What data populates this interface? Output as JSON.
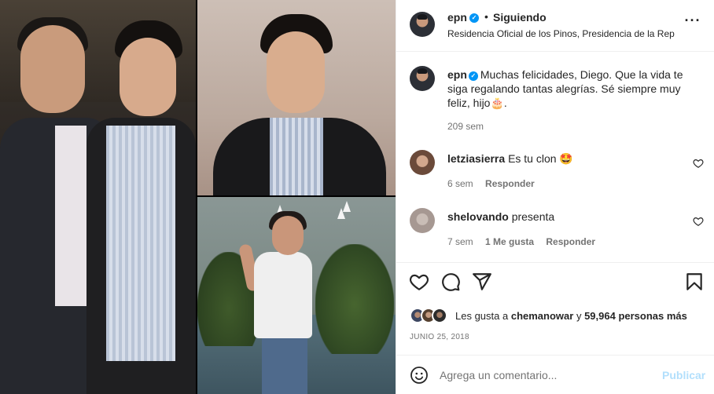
{
  "header": {
    "username": "epn",
    "separator": "•",
    "follow_label": "Siguiendo",
    "location": "Residencia Oficial de los Pinos, Presidencia de la Rep...",
    "more_label": "···"
  },
  "caption": {
    "username": "epn",
    "text": "Muchas felicidades, Diego. Que la vida te siga regalando tantas alegrías. Sé siempre muy feliz, hijo🎂.",
    "time": "209 sem"
  },
  "comments": [
    {
      "username": "letziasierra",
      "text": "Es tu clon 🤩",
      "time": "6 sem",
      "reply_label": "Responder"
    },
    {
      "username": "shelovando",
      "text": "presenta",
      "time": "7 sem",
      "likes_label": "1 Me gusta",
      "reply_label": "Responder"
    }
  ],
  "likes": {
    "prefix": "Les gusta a",
    "user": "chemanowar",
    "conjunction": "y",
    "count": "59,964 personas más"
  },
  "date": "JUNIO 25, 2018",
  "composer": {
    "placeholder": "Agrega un comentario...",
    "publish_label": "Publicar"
  },
  "colors": {
    "verified": "#0095f6",
    "publish": "#b2dffc",
    "muted": "#737373",
    "text": "#262626"
  },
  "icons": [
    "heart-icon",
    "comment-icon",
    "share-icon",
    "bookmark-icon",
    "emoji-icon",
    "more-icon",
    "verified-icon"
  ]
}
